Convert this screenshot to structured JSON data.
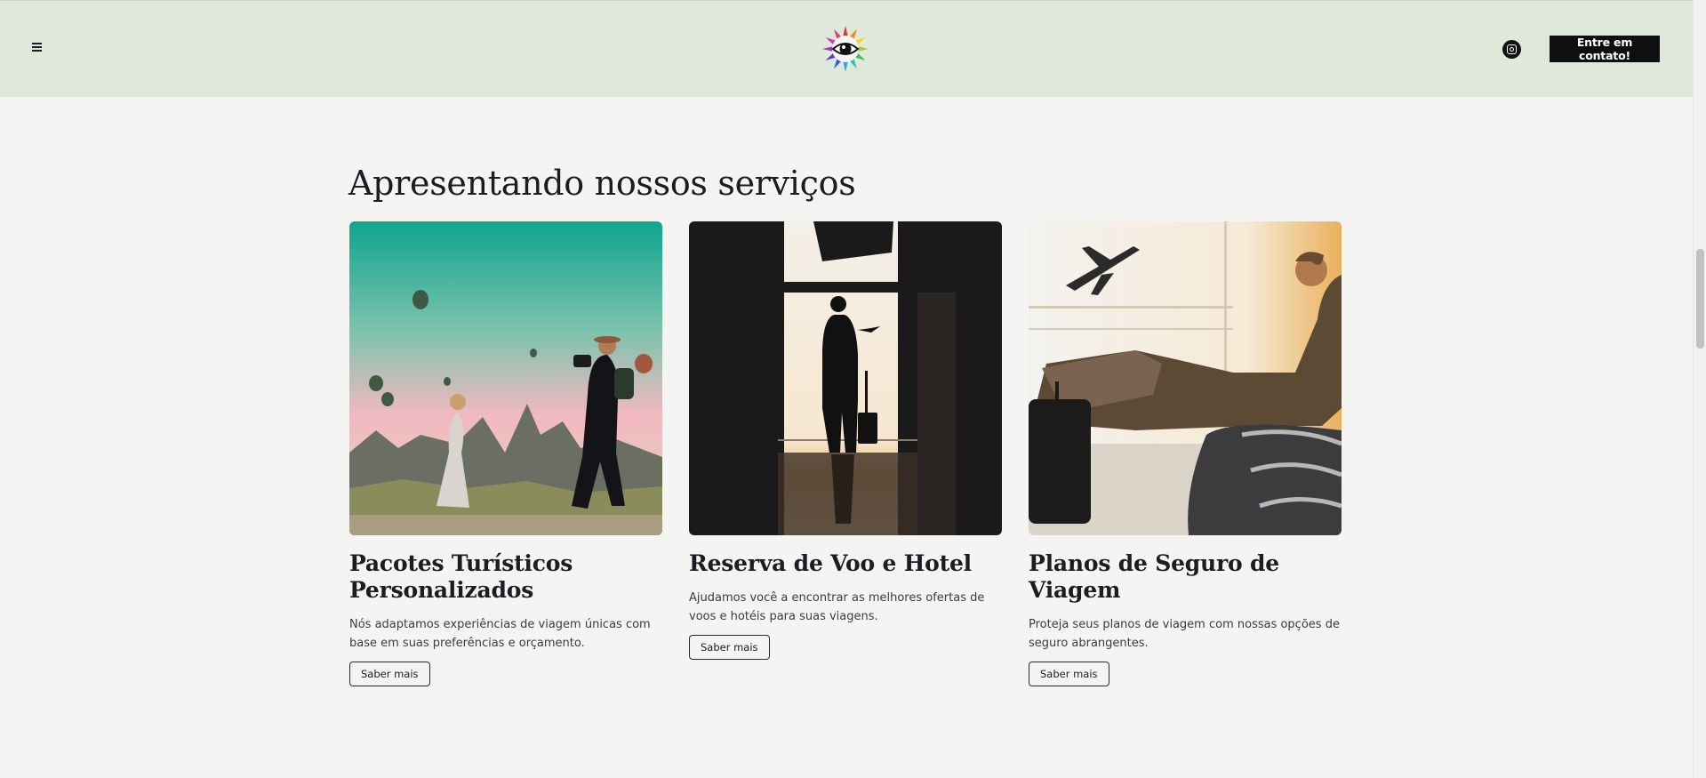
{
  "header": {
    "cta_label": "Entre em contato!"
  },
  "section": {
    "title": "Apresentando nossos serviços"
  },
  "services": [
    {
      "title": "Pacotes Turísticos Personalizados",
      "description": "Nós adaptamos experiências de viagem únicas com base em suas preferências e orçamento.",
      "button_label": "Saber mais"
    },
    {
      "title": "Reserva de Voo e Hotel",
      "description": "Ajudamos você a encontrar as melhores ofertas de voos e hotéis para suas viagens.",
      "button_label": "Saber mais"
    },
    {
      "title": "Planos de Seguro de Viagem",
      "description": "Proteja seus planos de viagem com nossas opções de seguro abrangentes.",
      "button_label": "Saber mais"
    }
  ],
  "icons": {
    "menu": "hamburger-menu-icon",
    "logo": "rainbow-eye-logo",
    "social": "instagram-icon"
  },
  "colors": {
    "header_bg": "#dfe8d9",
    "page_bg": "#f4f4f3",
    "cta_bg": "#0f0f12"
  }
}
